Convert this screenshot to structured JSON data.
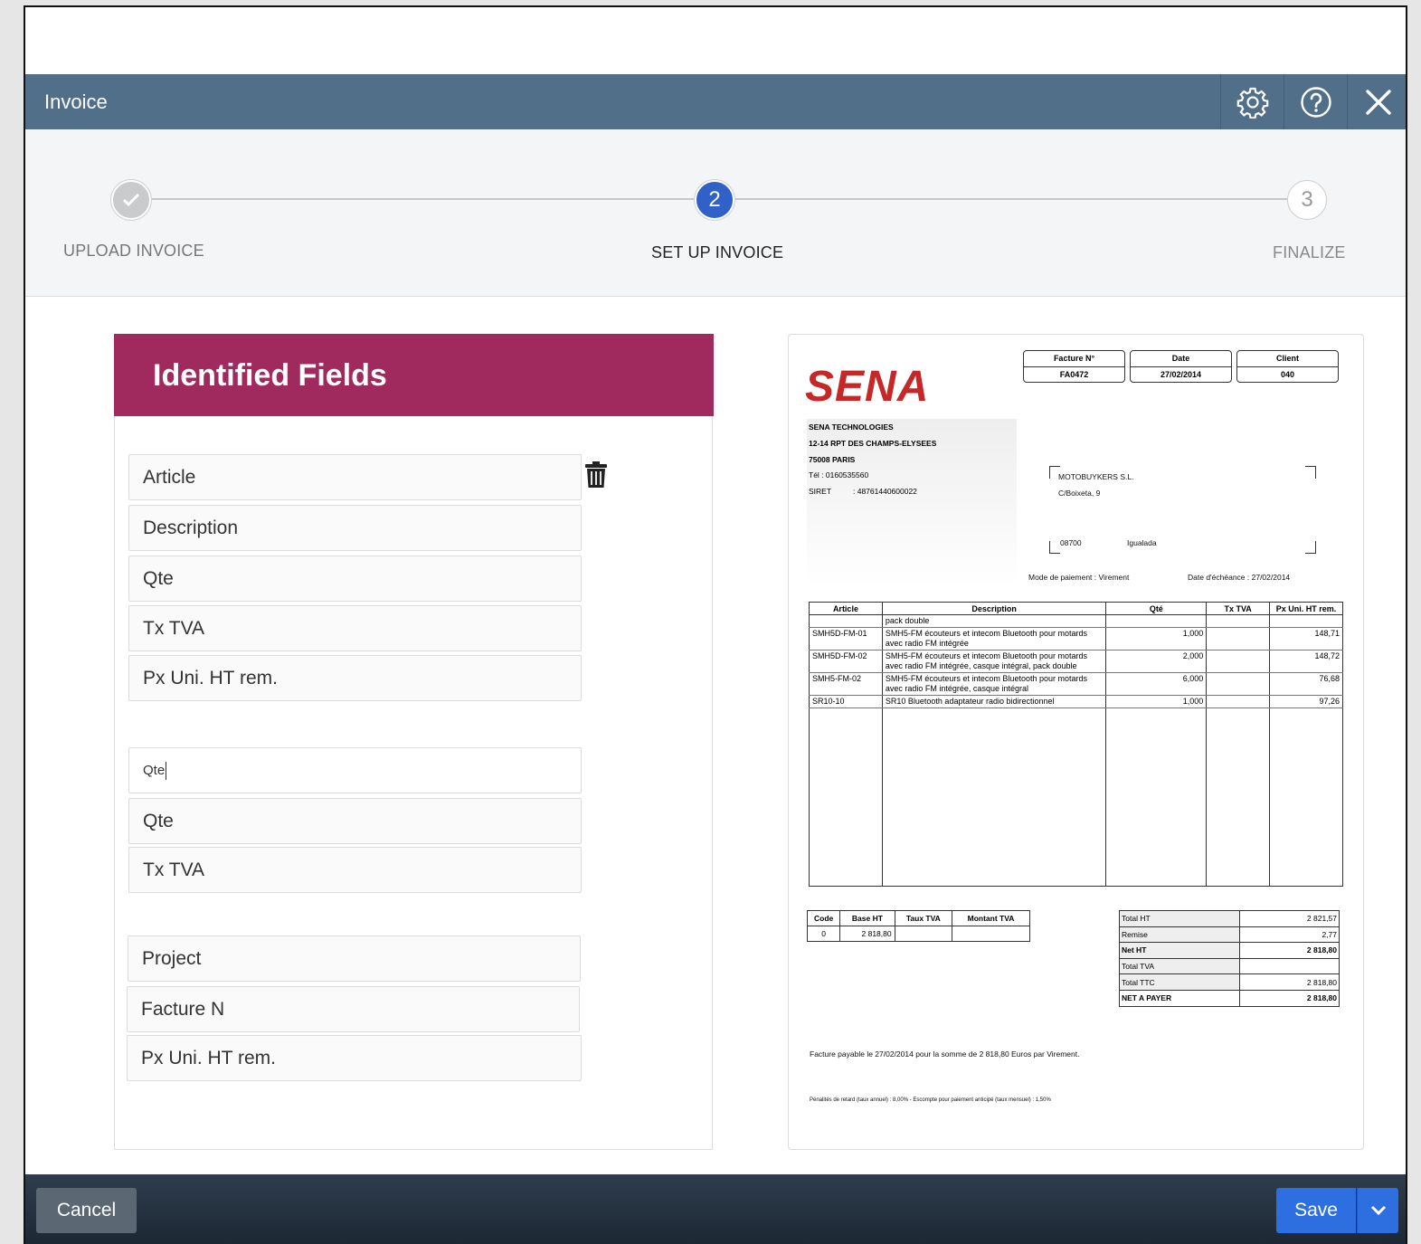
{
  "window": {
    "title": "Invoice"
  },
  "toolbar": {
    "settings_icon": "gear-icon",
    "help_icon": "help-circle-icon",
    "close_icon": "close-icon"
  },
  "steps": [
    {
      "label": "UPLOAD INVOICE",
      "marker": "✓",
      "state": "done"
    },
    {
      "label": "SET UP INVOICE",
      "marker": "2",
      "state": "active"
    },
    {
      "label": "FINALIZE",
      "marker": "3",
      "state": "pending"
    }
  ],
  "fields_panel": {
    "title": "Identified Fields",
    "group1": [
      "Article",
      "Description",
      "Qte",
      "Tx TVA",
      "Px Uni. HT rem."
    ],
    "group2_input_value": "Qte",
    "group2": [
      "Qte",
      "Tx TVA"
    ],
    "group3": [
      "Project",
      "Facture N",
      "Px Uni. HT rem."
    ]
  },
  "invoice": {
    "logo": "SENA",
    "header_boxes": [
      {
        "label": "Facture N°",
        "value": "FA0472"
      },
      {
        "label": "Date",
        "value": "27/02/2014"
      },
      {
        "label": "Client",
        "value": "040"
      }
    ],
    "sender": {
      "name": "SENA TECHNOLOGIES",
      "street": "12-14 RPT DES CHAMPS-ELYSEES",
      "city": "75008 PARIS",
      "tel": "Tél : 0160535560",
      "siret_label": "SIRET",
      "siret_value": ":   48761440600022"
    },
    "recipient": {
      "name": "MOTOBUYKERS S.L.",
      "street": "C/Boixeta, 9",
      "postcode": "08700",
      "city": "Igualada"
    },
    "payment_mode": "Mode de paiement :   Virement",
    "due_date": "Date d'échéance :   27/02/2014",
    "columns": [
      "Article",
      "Description",
      "Qté",
      "Tx TVA",
      "Px Uni. HT rem."
    ],
    "rows": [
      {
        "article": "",
        "description": "pack double",
        "qty": "",
        "tva": "",
        "price": ""
      },
      {
        "article": "SMH5D-FM-01",
        "description": "SMH5-FM écouteurs et intecom Bluetooth pour motards avec radio FM intégrée",
        "qty": "1,000",
        "tva": "",
        "price": "148,71"
      },
      {
        "article": "SMH5D-FM-02",
        "description": "SMH5-FM écouteurs et intecom Bluetooth pour motards avec radio FM intégrée, casque intégral, pack double",
        "qty": "2,000",
        "tva": "",
        "price": "148,72"
      },
      {
        "article": "SMH5-FM-02",
        "description": "SMH5-FM écouteurs et intecom Bluetooth pour motards avec radio FM intégrée, casque intégral",
        "qty": "6,000",
        "tva": "",
        "price": "76,68"
      },
      {
        "article": "SR10-10",
        "description": "SR10 Bluetooth adaptateur radio bidirectionnel",
        "qty": "1,000",
        "tva": "",
        "price": "97,26"
      }
    ],
    "tax_columns": [
      "Code",
      "Base HT",
      "Taux TVA",
      "Montant TVA"
    ],
    "tax_row": [
      "0",
      "2 818,80",
      "",
      ""
    ],
    "totals": [
      {
        "label": "Total HT",
        "value": "2 821,57",
        "bold": false
      },
      {
        "label": "Remise",
        "value": "2,77",
        "bold": false
      },
      {
        "label": "Net HT",
        "value": "2 818,80",
        "bold": true
      },
      {
        "label": "Total TVA",
        "value": "",
        "bold": false
      },
      {
        "label": "Total TTC",
        "value": "2 818,80",
        "bold": false
      },
      {
        "label": "NET A PAYER",
        "value": "2 818,80",
        "bold": true
      }
    ],
    "payable_note": "Facture payable le 27/02/2014 pour la somme de 2 818,80 Euros par Virement.",
    "penalty_note": "Pénalités de retard (taux annuel) : 8,00% - Escompte pour paiement anticipé (taux mensuel) : 1,50%"
  },
  "footer": {
    "cancel_label": "Cancel",
    "save_label": "Save"
  },
  "colors": {
    "titlebar": "#526f8a",
    "panel_header": "#a0295e",
    "accent": "#2d6fe0",
    "logo": "#c62828"
  }
}
